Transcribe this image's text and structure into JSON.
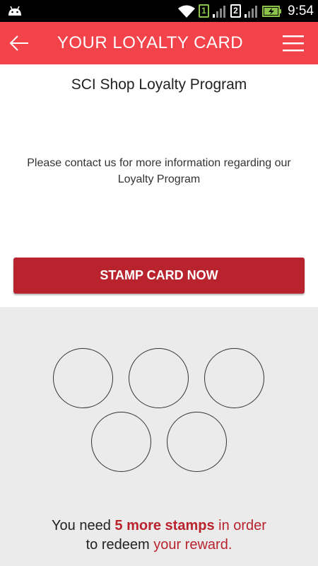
{
  "status_bar": {
    "time": "9:54",
    "sim1": "1",
    "sim2": "2",
    "icons": [
      "android-icon",
      "wifi-icon",
      "signal-icon",
      "battery-charging-icon"
    ]
  },
  "app_bar": {
    "title": "YOUR LOYALTY CARD",
    "icons": [
      "back-arrow-icon",
      "hamburger-menu-icon"
    ]
  },
  "program": {
    "name": "SCI Shop Loyalty Program",
    "info": "Please contact us for more information regarding our Loyalty Program"
  },
  "stamp_button_label": "STAMP CARD NOW",
  "stamps": {
    "total": 5,
    "filled": 0
  },
  "reward": {
    "part1": "You need ",
    "count_text": "5 more stamps",
    "part2": " in order",
    "part3": "to redeem ",
    "part4": "your reward."
  },
  "colors": {
    "app_bar": "#f2424a",
    "button": "#b8232d",
    "accent_text": "#b8232d",
    "stamps_background": "#ebebeb"
  }
}
